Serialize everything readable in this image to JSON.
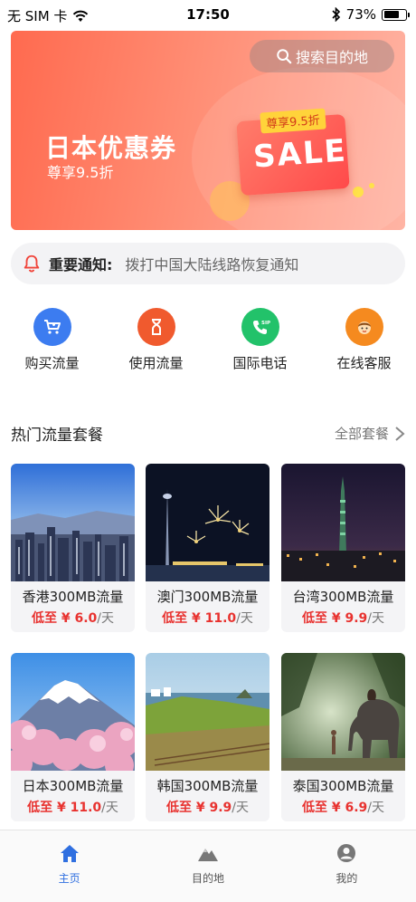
{
  "status_bar": {
    "carrier": "无 SIM 卡",
    "time": "17:50",
    "battery_percent": "73%",
    "battery_level": 0.73
  },
  "banner": {
    "search_label": "搜索目的地",
    "title": "日本优惠券",
    "subtitle": "尊享9.5折",
    "sale_tag": "尊享9.5折",
    "sale_text": "SALE"
  },
  "notice": {
    "label": "重要通知:",
    "text": "拨打中国大陆线路恢复通知"
  },
  "quick_menu": [
    {
      "label": "购买流量",
      "icon": "cart-icon",
      "color": "#3c7cf0"
    },
    {
      "label": "使用流量",
      "icon": "hourglass-icon",
      "color": "#f05a2e"
    },
    {
      "label": "国际电话",
      "icon": "sip-phone-icon",
      "color": "#22c26a"
    },
    {
      "label": "在线客服",
      "icon": "customer-service-icon",
      "color": "#f58a1f"
    }
  ],
  "section": {
    "title": "热门流量套餐",
    "more_label": "全部套餐"
  },
  "packages": [
    {
      "name": "香港300MB流量",
      "price_prefix": "低至 ¥ ",
      "price": "6.0",
      "unit": "/天",
      "image": "hong-kong-skyline"
    },
    {
      "name": "澳门300MB流量",
      "price_prefix": "低至 ¥ ",
      "price": "11.0",
      "unit": "/天",
      "image": "macau-tower-fireworks"
    },
    {
      "name": "台湾300MB流量",
      "price_prefix": "低至 ¥ ",
      "price": "9.9",
      "unit": "/天",
      "image": "taipei-101-night"
    },
    {
      "name": "日本300MB流量",
      "price_prefix": "低至 ¥ ",
      "price": "11.0",
      "unit": "/天",
      "image": "mount-fuji-sakura"
    },
    {
      "name": "韩国300MB流量",
      "price_prefix": "低至 ¥ ",
      "price": "9.9",
      "unit": "/天",
      "image": "korea-coast"
    },
    {
      "name": "泰国300MB流量",
      "price_prefix": "低至 ¥ ",
      "price": "6.9",
      "unit": "/天",
      "image": "thailand-elephant"
    }
  ],
  "tab_bar": [
    {
      "label": "主页",
      "icon": "home-icon",
      "active": true
    },
    {
      "label": "目的地",
      "icon": "mountain-icon",
      "active": false
    },
    {
      "label": "我的",
      "icon": "profile-icon",
      "active": false
    }
  ],
  "colors": {
    "accent": "#2f6fe0",
    "price": "#e8322f",
    "banner": "#ff6a4f"
  }
}
